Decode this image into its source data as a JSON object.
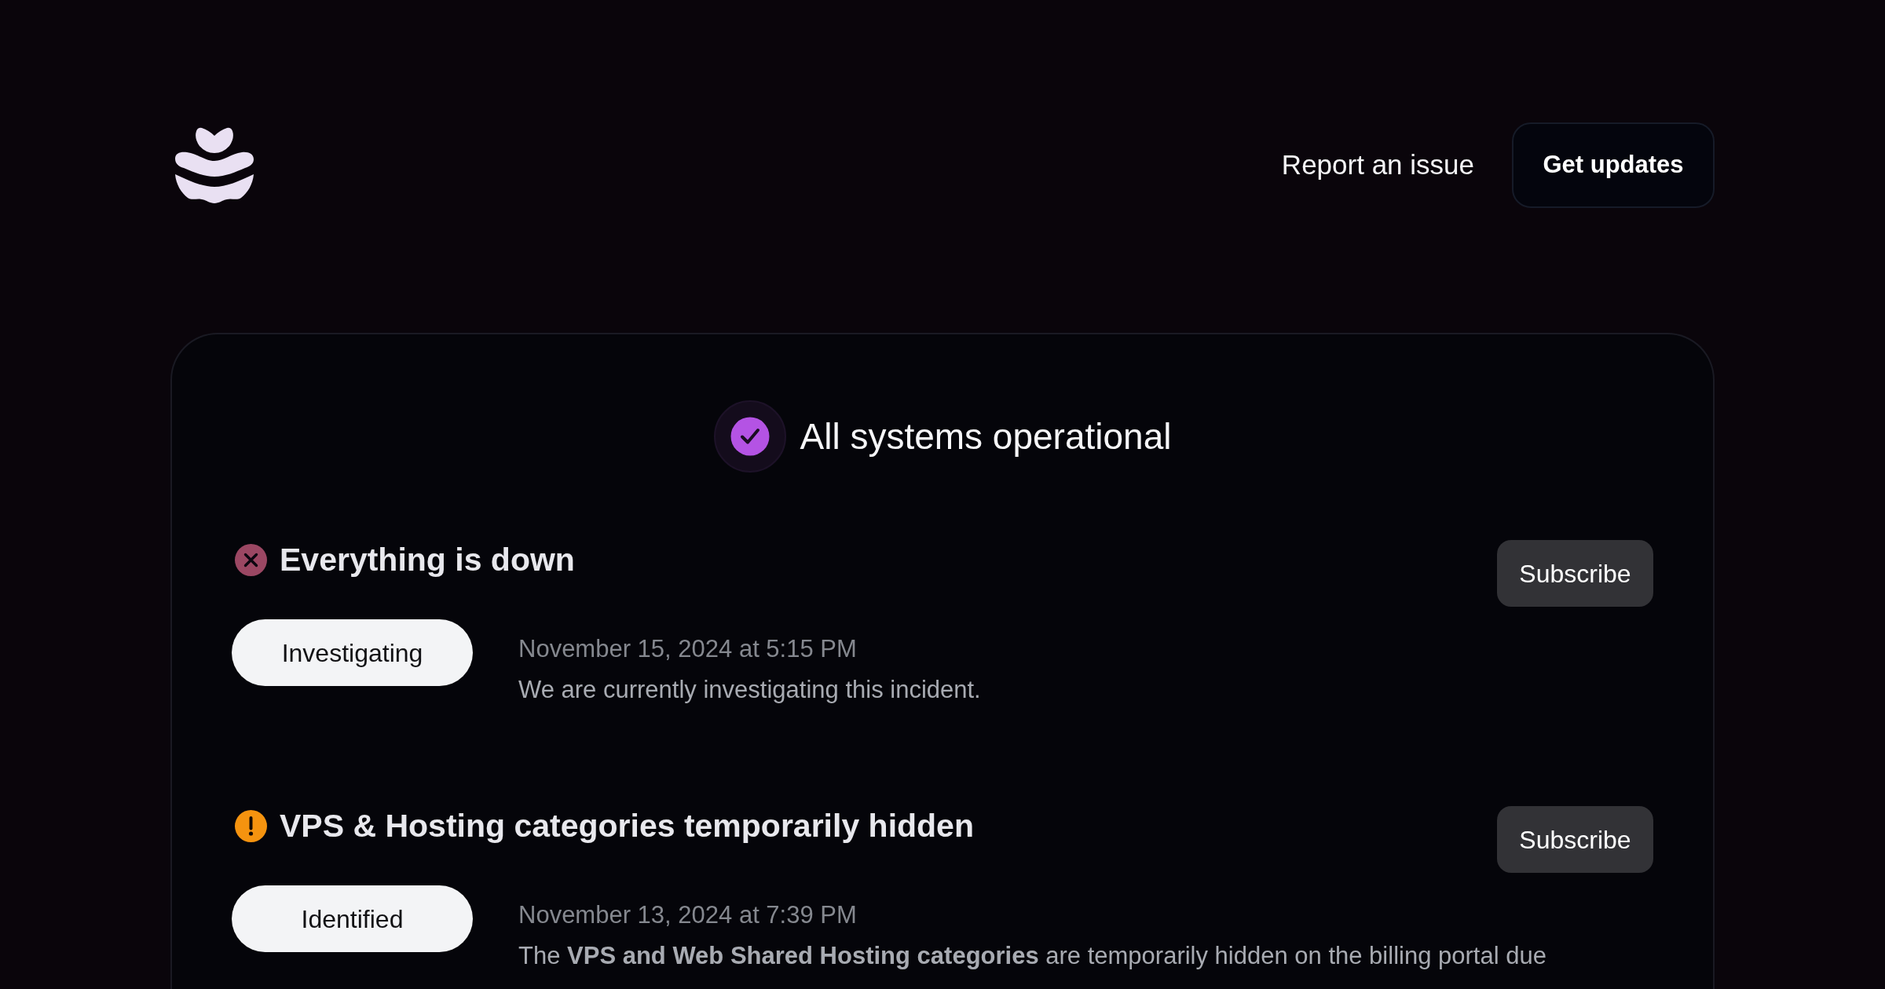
{
  "header": {
    "report_link": "Report an issue",
    "updates_button": "Get updates"
  },
  "status": {
    "kind": "operational",
    "label": "All systems operational"
  },
  "incidents": [
    {
      "kind": "major",
      "title": "Everything is down",
      "subscribe_button": "Subscribe",
      "state": "Investigating",
      "date": "November 15, 2024 at 5:15 PM",
      "message": "We are currently investigating this incident."
    },
    {
      "kind": "minor",
      "title": "VPS & Hosting categories temporarily hidden",
      "subscribe_button": "Subscribe",
      "state": "Identified",
      "date": "November 13, 2024 at 7:39 PM",
      "message": "The **VPS and Web Shared Hosting categories** are temporarily hidden on the billing portal due"
    }
  ]
}
